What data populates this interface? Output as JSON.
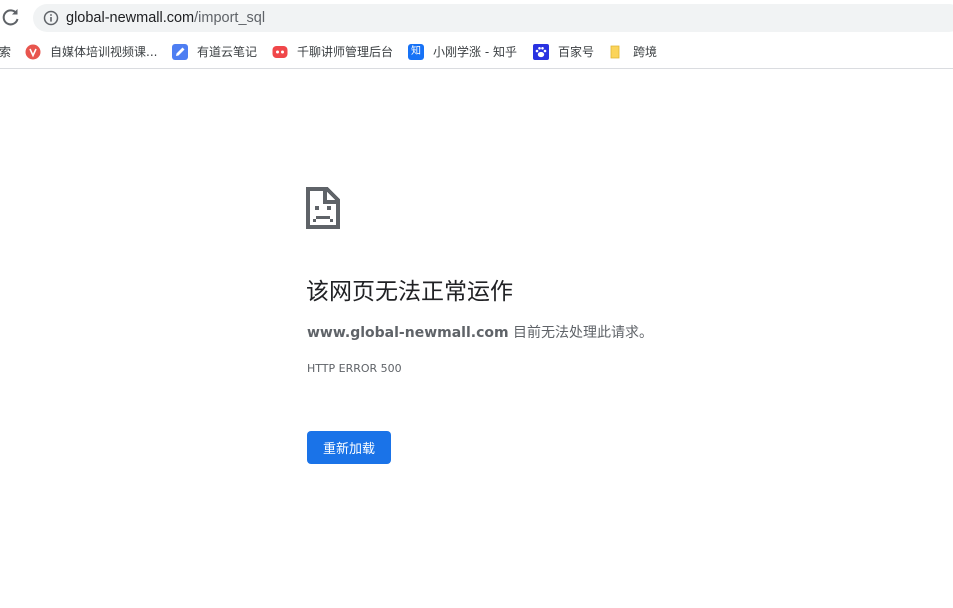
{
  "omnibox": {
    "url_host": "global-newmall.com",
    "url_path": "/import_sql"
  },
  "bookmarks": {
    "items": [
      {
        "label": "索",
        "icon": "none"
      },
      {
        "label": "自媒体培训视频课...",
        "icon": "red-v-circle-icon"
      },
      {
        "label": "有道云笔记",
        "icon": "youdao-note-icon"
      },
      {
        "label": "千聊讲师管理后台",
        "icon": "qianliao-icon"
      },
      {
        "label": "小刚学涨 - 知乎",
        "icon": "zhihu-icon"
      },
      {
        "label": "百家号",
        "icon": "baidu-paw-icon"
      },
      {
        "label": "跨境",
        "icon": "folder-icon"
      }
    ],
    "zhihu_glyph": "知"
  },
  "error": {
    "title": "该网页无法正常运作",
    "domain": "www.global-newmall.com",
    "message": " 目前无法处理此请求。",
    "code": "HTTP ERROR 500",
    "reload_label": "重新加载"
  },
  "colors": {
    "accent": "#1a73e8",
    "omnibox_bg": "#f1f3f4",
    "text": "#202124",
    "secondary_text": "#5f6368"
  }
}
